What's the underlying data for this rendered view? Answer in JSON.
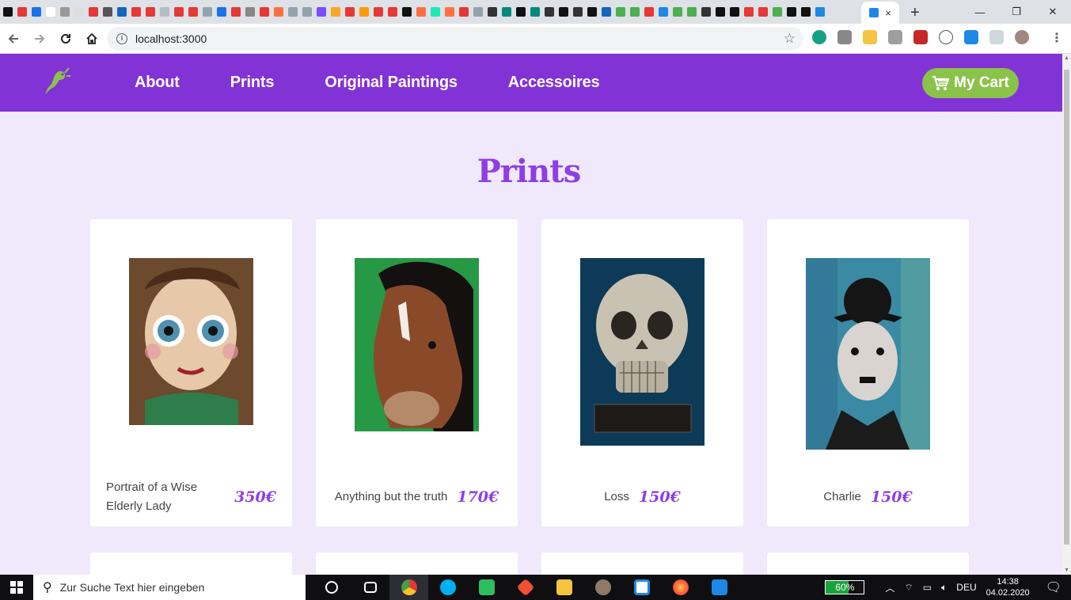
{
  "browser": {
    "url": "localhost:3000",
    "tab_favicons": [
      "#111",
      "#e53935",
      "#1a73e8",
      "#fff",
      "#999",
      "#ddd",
      "#e53935",
      "#555",
      "#1565c0",
      "#e53935",
      "#e53935",
      "#b0bec5",
      "#e53935",
      "#e53935",
      "#90a4ae",
      "#1a73e8",
      "#e53935",
      "#888",
      "#e53935",
      "#ff7043",
      "#90a4ae",
      "#90a4ae",
      "#7c4dff",
      "#f9a825",
      "#e53935",
      "#ff9800",
      "#e53935",
      "#e53935",
      "#111",
      "#ff7043",
      "#1de9b6",
      "#ff7043",
      "#e53935",
      "#90a4ae",
      "#333",
      "#00897b",
      "#111",
      "#00897b",
      "#333",
      "#111",
      "#333",
      "#111",
      "#1565c0",
      "#4caf50",
      "#4caf50",
      "#e53935",
      "#1e88e5",
      "#4caf50",
      "#4caf50",
      "#333",
      "#111",
      "#111",
      "#e53935",
      "#e53935",
      "#4caf50",
      "#111",
      "#111",
      "#1e88e5"
    ],
    "tab_close": "×",
    "new_tab": "+",
    "window": {
      "minimize": "—",
      "restore": "❐",
      "close": "✕"
    }
  },
  "site": {
    "nav": [
      "About",
      "Prints",
      "Original Paintings",
      "Accessoires"
    ],
    "cart_label": "My Cart",
    "page_title": "Prints",
    "products": [
      {
        "name": "Portrait of a Wise Elderly Lady",
        "price": "350€"
      },
      {
        "name": "Anything but the truth",
        "price": "170€"
      },
      {
        "name": "Loss",
        "price": "150€"
      },
      {
        "name": "Charlie",
        "price": "150€"
      }
    ],
    "colors": {
      "accent": "#8233d6",
      "title": "#8e3fe3",
      "cart": "#8bc34a",
      "page_bg": "#efe9fb"
    }
  },
  "taskbar": {
    "search_placeholder": "Zur Suche Text hier eingeben",
    "battery": "60%",
    "language": "DEU",
    "time": "14:38",
    "date": "04.02.2020"
  }
}
